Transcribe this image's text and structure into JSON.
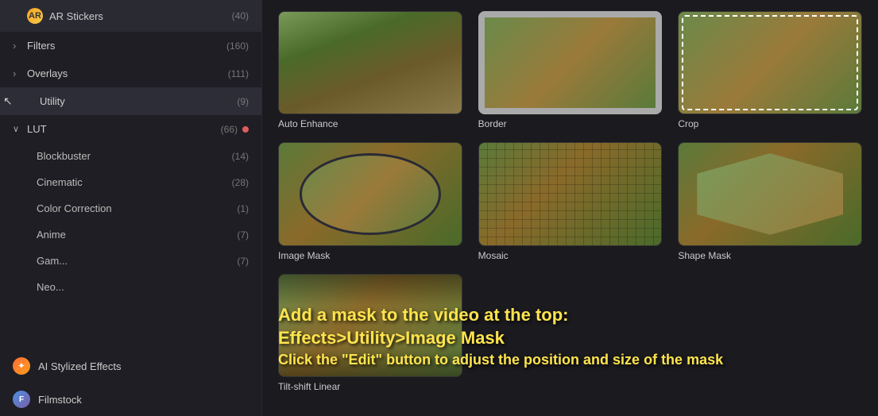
{
  "sidebar": {
    "items": [
      {
        "id": "ar-stickers",
        "label": "AR Stickers",
        "count": "(40)",
        "arrow": "",
        "hasIcon": true,
        "iconType": "ar",
        "indent": false
      },
      {
        "id": "filters",
        "label": "Filters",
        "count": "(160)",
        "arrow": "›",
        "indent": false
      },
      {
        "id": "overlays",
        "label": "Overlays",
        "count": "(111)",
        "arrow": "›",
        "indent": false
      },
      {
        "id": "utility",
        "label": "Utility",
        "count": "(9)",
        "arrow": "",
        "indent": false,
        "active": true,
        "hasCursor": true
      },
      {
        "id": "lut",
        "label": "LUT",
        "count": "(66)",
        "arrow": "∨",
        "indent": false,
        "hasDot": true
      },
      {
        "id": "blockbuster",
        "label": "Blockbuster",
        "count": "(14)",
        "indent": true
      },
      {
        "id": "cinematic",
        "label": "Cinematic",
        "count": "(28)",
        "indent": true
      },
      {
        "id": "color-correction",
        "label": "Color Correction",
        "count": "(1)",
        "indent": true
      },
      {
        "id": "anime",
        "label": "Anime",
        "count": "(7)",
        "indent": true,
        "hasDot": true
      },
      {
        "id": "gaming",
        "label": "Gam...",
        "count": "(7)",
        "indent": true
      },
      {
        "id": "neon",
        "label": "Neo...",
        "count": "...",
        "indent": true
      }
    ],
    "bottom_items": [
      {
        "id": "ai-stylized",
        "label": "AI Stylized Effects",
        "iconType": "ai1"
      },
      {
        "id": "filmstock",
        "label": "Filmstock",
        "iconType": "ai2"
      }
    ]
  },
  "effects": {
    "items": [
      {
        "id": "auto-enhance",
        "label": "Auto Enhance",
        "thumbClass": "tv-autoenh"
      },
      {
        "id": "border",
        "label": "Border",
        "thumbClass": "tv-border"
      },
      {
        "id": "crop",
        "label": "Crop",
        "thumbClass": "tv-crop"
      },
      {
        "id": "image-mask",
        "label": "Image Mask",
        "thumbClass": "thumb-circle"
      },
      {
        "id": "mosaic",
        "label": "Mosaic",
        "thumbClass": "tv-mosaic"
      },
      {
        "id": "shape-mask",
        "label": "Shape Mask",
        "thumbClass": "tv-shapemask"
      },
      {
        "id": "tilt-shift-linear",
        "label": "Tilt-shift Linear",
        "thumbClass": "tv-tiltshift"
      }
    ]
  },
  "instructions": {
    "line1": "Add a mask to the video at the top:",
    "line2": "Effects>Utility>Image Mask",
    "line3": "Click the \"Edit\" button to adjust the position and size of the mask"
  },
  "collapse_btn": "‹"
}
